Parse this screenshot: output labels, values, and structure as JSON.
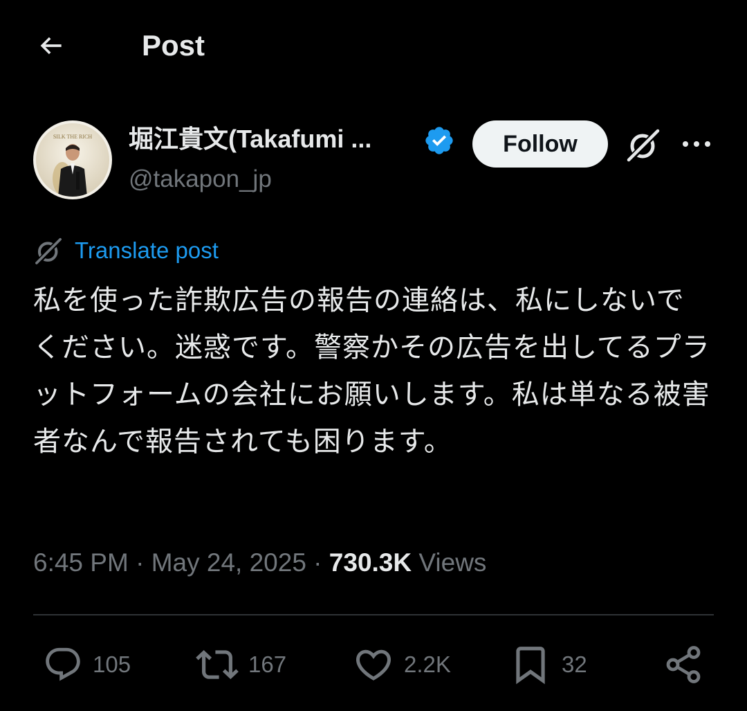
{
  "header": {
    "title": "Post",
    "back_icon": "arrow-left-icon"
  },
  "author": {
    "name": "堀江貴文(Takafumi ...",
    "handle": "@takapon_jp",
    "verified": true,
    "verified_color": "#1d9bf0",
    "avatar_text": "SILK THE RICH",
    "follow_label": "Follow"
  },
  "translate": {
    "label": "Translate post"
  },
  "post": {
    "text": "私を使った詐欺広告の報告の連絡は、私にしないでください。迷惑です。警察かその広告を出してるプラットフォームの会社にお願いします。私は単なる被害者なんで報告されても困ります。"
  },
  "meta": {
    "time": "6:45 PM",
    "sep1": " · ",
    "date": "May 24, 2025",
    "sep2": " · ",
    "views_count": "730.3K",
    "views_label": " Views"
  },
  "actions": {
    "replies": "105",
    "reposts": "167",
    "likes": "2.2K",
    "bookmarks": "32"
  },
  "colors": {
    "background": "#000000",
    "text": "#e7e9ea",
    "secondary": "#71767b",
    "accent": "#1d9bf0",
    "divider": "#2f3336"
  }
}
